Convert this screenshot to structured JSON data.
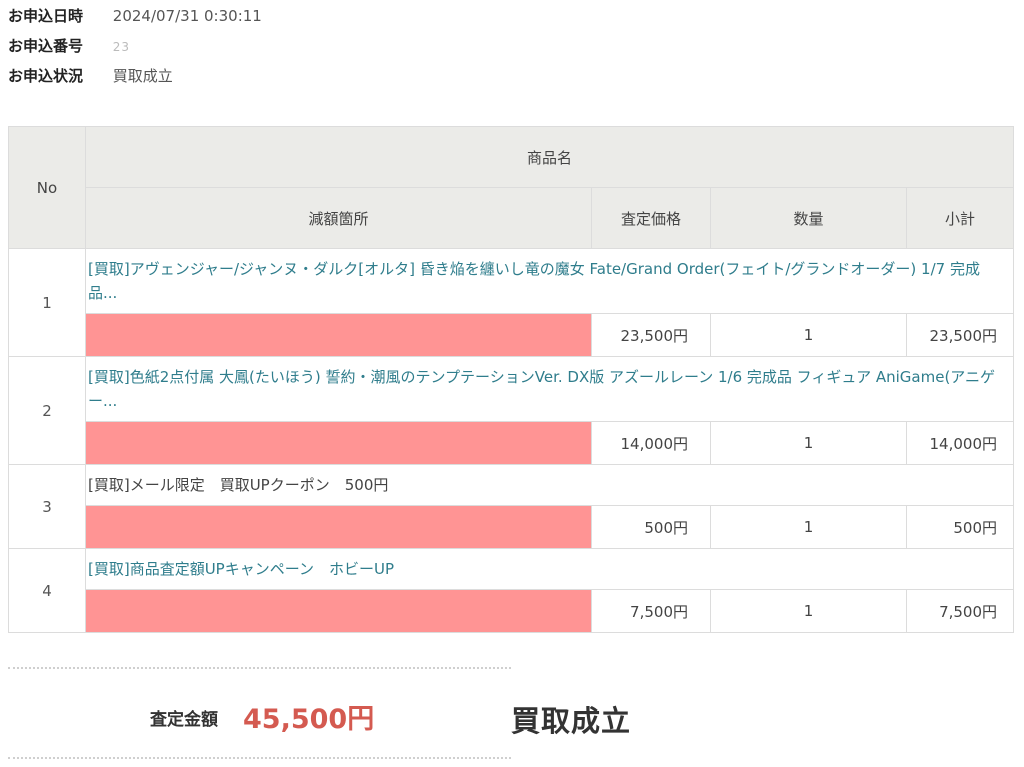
{
  "info": [
    {
      "label": "お申込日時",
      "value": "2024/07/31 0:30:11"
    },
    {
      "label": "お申込番号",
      "value": "23"
    },
    {
      "label": "お申込状況",
      "value": "買取成立"
    }
  ],
  "table": {
    "headers": {
      "no": "No",
      "product_name": "商品名",
      "reduction": "減額箇所",
      "price": "査定価格",
      "quantity": "数量",
      "subtotal": "小計"
    },
    "rows": [
      {
        "no": "1",
        "name": "[買取]アヴェンジャー/ジャンヌ・ダルク[オルタ] 昏き焔を纏いし竜の魔女 Fate/Grand Order(フェイト/グランドオーダー) 1/7 完成品...",
        "price": "23,500円",
        "qty": "1",
        "subtotal": "23,500円"
      },
      {
        "no": "2",
        "name": "[買取]色紙2点付属 大鳳(たいほう) 誓約・潮風のテンプテーションVer. DX版 アズールレーン 1/6 完成品 フィギュア AniGame(アニゲー...",
        "price": "14,000円",
        "qty": "1",
        "subtotal": "14,000円"
      },
      {
        "no": "3",
        "name": "[買取]メール限定　買取UPクーポン　500円",
        "price": "500円",
        "qty": "1",
        "subtotal": "500円"
      },
      {
        "no": "4",
        "name": "[買取]商品査定額UPキャンペーン　ホビーUP",
        "price": "7,500円",
        "qty": "1",
        "subtotal": "7,500円"
      }
    ]
  },
  "summary": {
    "label": "査定金額",
    "amount": "45,500円",
    "status": "買取成立"
  },
  "colors": {
    "link": "#2f7d8c",
    "redaction": "#ff9494",
    "amount": "#d45a50",
    "header_bg": "#ebebe8"
  }
}
